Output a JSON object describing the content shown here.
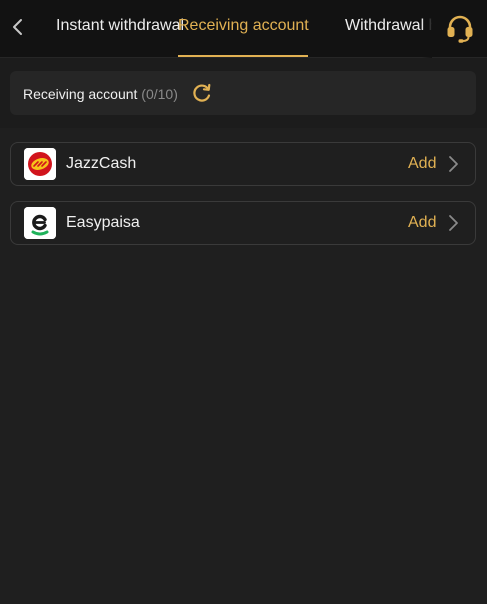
{
  "header": {
    "back_icon": "chevron-left-icon",
    "tabs": [
      {
        "label": "Instant withdrawal"
      },
      {
        "label": "Receiving account"
      },
      {
        "label": "Withdrawal history"
      }
    ],
    "active_tab": "Receiving account",
    "support_icon": "headset-icon"
  },
  "info_bar": {
    "title": "Receiving account",
    "count": "(0/10)",
    "refresh_icon": "refresh-icon"
  },
  "accounts": [
    {
      "name": "JazzCash",
      "action": "Add",
      "logo_icon": "jazzcash-logo-icon"
    },
    {
      "name": "Easypaisa",
      "action": "Add",
      "logo_icon": "easypaisa-logo-icon"
    }
  ],
  "colors": {
    "accent": "#e1b153",
    "background": "#1c1c1c",
    "header_background": "#121212",
    "card_background": "#262626",
    "muted_text": "#8a8a8a"
  }
}
